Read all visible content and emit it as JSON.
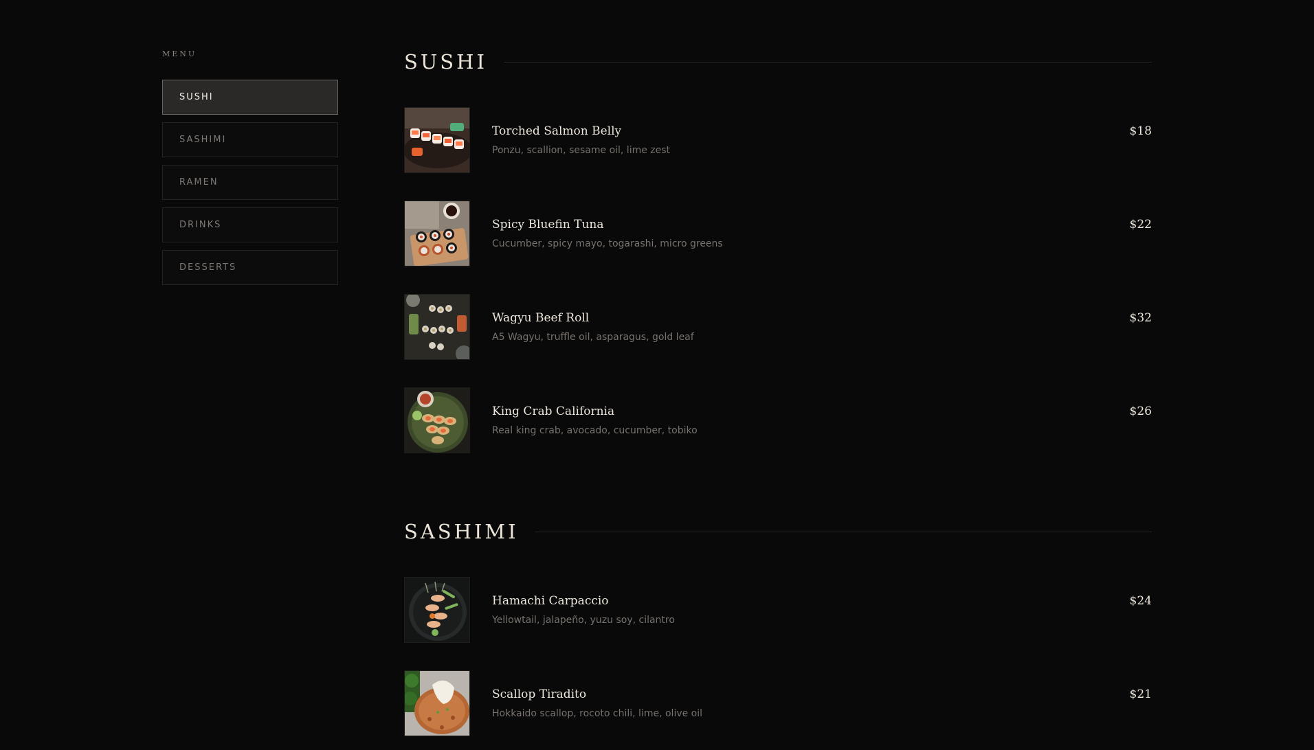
{
  "sidebar": {
    "heading": "MENU",
    "items": [
      {
        "label": "SUSHI",
        "active": true
      },
      {
        "label": "SASHIMI",
        "active": false
      },
      {
        "label": "RAMEN",
        "active": false
      },
      {
        "label": "DRINKS",
        "active": false
      },
      {
        "label": "DESSERTS",
        "active": false
      }
    ]
  },
  "sections": [
    {
      "title": "SUSHI",
      "items": [
        {
          "name": "Torched Salmon Belly",
          "description": "Ponzu, scallion, sesame oil, lime zest",
          "price": "$18",
          "image": "sushi-platter-photo"
        },
        {
          "name": "Spicy Bluefin Tuna",
          "description": "Cucumber, spicy mayo, togarashi, micro greens",
          "price": "$22",
          "image": "sushi-rolls-board-photo"
        },
        {
          "name": "Wagyu Beef Roll",
          "description": "A5 Wagyu, truffle oil, asparagus, gold leaf",
          "price": "$32",
          "image": "sushi-spread-photo"
        },
        {
          "name": "King Crab California",
          "description": "Real king crab, avocado, cucumber, tobiko",
          "price": "$26",
          "image": "california-roll-plate-photo"
        }
      ]
    },
    {
      "title": "SASHIMI",
      "items": [
        {
          "name": "Hamachi Carpaccio",
          "description": "Yellowtail, jalapeño, yuzu soy, cilantro",
          "price": "$24",
          "image": "carpaccio-plate-photo"
        },
        {
          "name": "Scallop Tiradito",
          "description": "Hokkaido scallop, rocoto chili, lime, olive oil",
          "price": "$21",
          "image": "scallop-dish-photo"
        }
      ]
    }
  ]
}
